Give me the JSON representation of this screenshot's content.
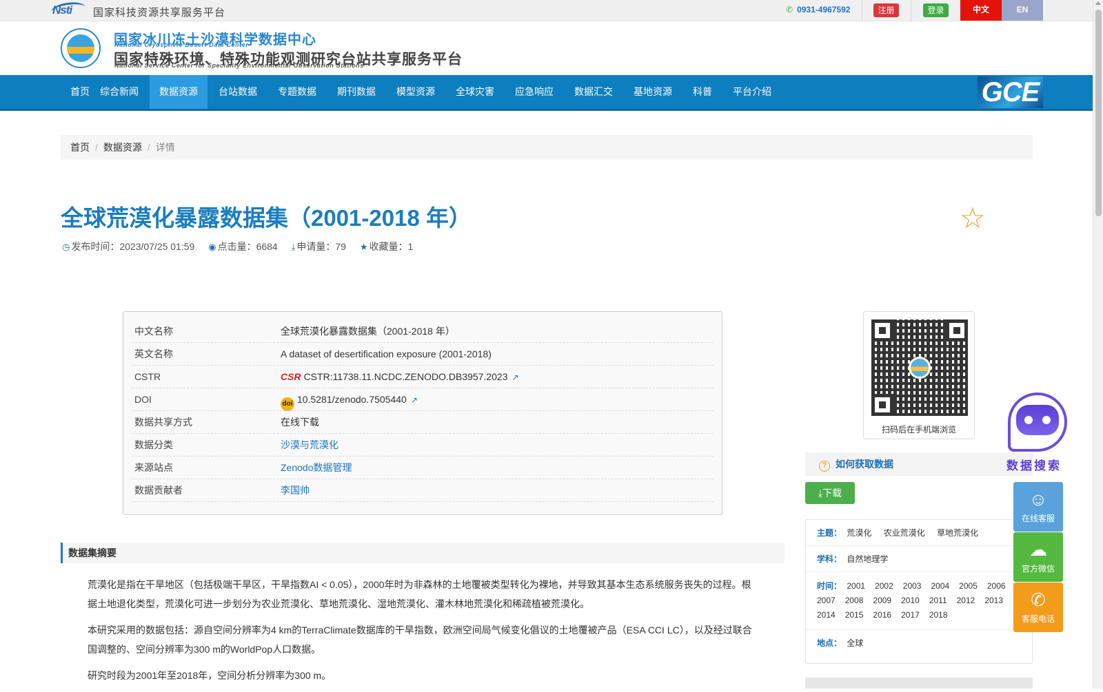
{
  "topbar": {
    "logo_text": "Nsti",
    "platform_title": "国家科技资源共享服务平台",
    "phone": "0931-4967592",
    "register_label": "注册",
    "login_label": "登录",
    "lang_zh": "中文",
    "lang_en": "EN"
  },
  "header": {
    "title_cn": "国家冰川冻土沙漠科学数据中心",
    "title_en": "National Cryosphere Desert Data Center",
    "subtitle_cn": "国家特殊环境、特殊功能观测研究台站共享服务平台",
    "subtitle_en": "National Service Center for Speciality Environmental Observation Stations"
  },
  "nav": {
    "items": [
      "首页",
      "综合新闻",
      "数据资源",
      "台站数据",
      "专题数据",
      "期刊数据",
      "模型资源",
      "全球灾害",
      "应急响应",
      "数据汇交",
      "基地资源",
      "科普",
      "平台介绍"
    ],
    "active_index": 2,
    "badge": "GCE"
  },
  "breadcrumb": {
    "home": "首页",
    "section": "数据资源",
    "current": "详情"
  },
  "dataset": {
    "title": "全球荒漠化暴露数据集（2001-2018 年）",
    "published_label": "发布时间：",
    "published": "2023/07/25 01:59",
    "clicks_label": "点击量：",
    "clicks": "6684",
    "requests_label": "申请量：",
    "requests": "79",
    "favorites_label": "收藏量：",
    "favorites": "1"
  },
  "info": {
    "rows": [
      {
        "key": "中文名称",
        "value": "全球荒漠化暴露数据集（2001-2018 年）"
      },
      {
        "key": "英文名称",
        "value": "A dataset of desertification exposure (2001-2018)"
      },
      {
        "key": "CSTR",
        "value": "CSTR:11738.11.NCDC.ZENODO.DB3957.2023"
      },
      {
        "key": "DOI",
        "value": "10.5281/zenodo.7505440"
      },
      {
        "key": "数据共享方式",
        "value": "在线下载"
      },
      {
        "key": "数据分类",
        "value": "沙漠与荒漠化"
      },
      {
        "key": "来源站点",
        "value": "Zenodo数据管理"
      },
      {
        "key": "数据贡献者",
        "value": "李国帅"
      }
    ],
    "cstr_mark": "CSR",
    "doi_mark": "doi"
  },
  "summary": {
    "heading": "数据集摘要",
    "paragraphs": [
      "荒漠化是指在干旱地区（包括极端干旱区，干旱指数AI < 0.05），2000年时为非森林的土地覆被类型转化为裸地，并导致其基本生态系统服务丧失的过程。根据土地退化类型，荒漠化可进一步划分为农业荒漠化、草地荒漠化、湿地荒漠化、灌木林地荒漠化和稀疏植被荒漠化。",
      "本研究采用的数据包括：源自空间分辨率为4 km的TerraClimate数据库的干旱指数，欧洲空间局气候变化倡议的土地覆被产品（ESA CCI LC），以及经过联合国调整的、空间分辨率为300 m的WorldPop人口数据。",
      "研究时段为2001年至2018年，空间分析分辨率为300 m。"
    ]
  },
  "sidebar": {
    "qr_caption": "扫码后在手机端浏览",
    "howto_label": "如何获取数据",
    "download_label": "下载",
    "theme_label": "主题：",
    "themes": [
      "荒漠化",
      "农业荒漠化",
      "草地荒漠化"
    ],
    "discipline_label": "学科：",
    "discipline": "自然地理学",
    "time_label": "时间：",
    "years": [
      "2001",
      "2002",
      "2003",
      "2004",
      "2005",
      "2006",
      "2007",
      "2008",
      "2009",
      "2010",
      "2011",
      "2012",
      "2013",
      "2014",
      "2015",
      "2016",
      "2017",
      "2018"
    ],
    "location_label": "地点：",
    "location": "全球"
  },
  "floating": {
    "search_label": "数据搜索",
    "qq_label": "在线客服",
    "wechat_label": "官方微信",
    "phone_label": "客服电话"
  },
  "colors": {
    "nav_bg": "#0d7ebf",
    "title_blue": "#1a7dbf",
    "register_red": "#d9363e",
    "login_green": "#3fab44",
    "lang_zh_red": "#e3130c",
    "lang_en_blue": "#9aa6c9"
  }
}
